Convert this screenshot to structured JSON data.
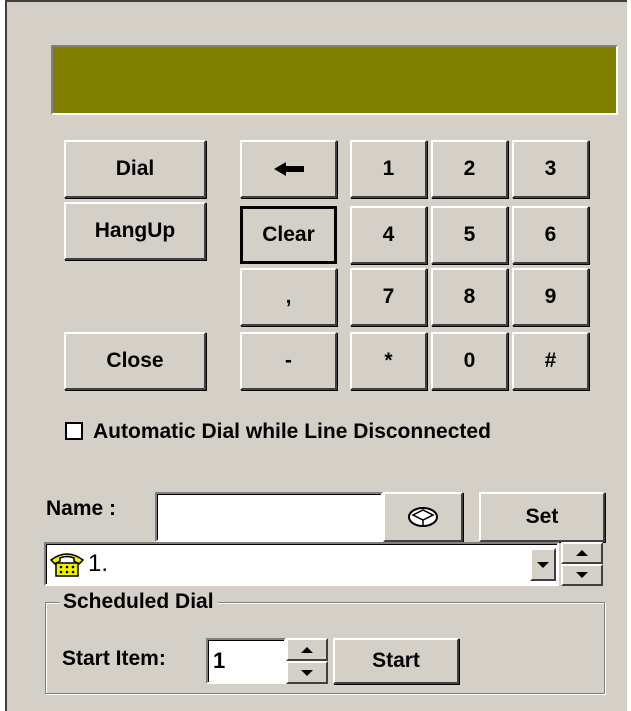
{
  "display": {
    "text": ""
  },
  "left_buttons": {
    "dial": "Dial",
    "hangup": "HangUp",
    "close": "Close"
  },
  "edit_buttons": {
    "backspace": "←",
    "clear": "Clear",
    "comma": ",",
    "dash": "-"
  },
  "keypad": [
    "1",
    "2",
    "3",
    "4",
    "5",
    "6",
    "7",
    "8",
    "9",
    "*",
    "0",
    "#"
  ],
  "auto_dial": {
    "label": "Automatic Dial while Line Disconnected",
    "checked": false
  },
  "name": {
    "label": "Name :",
    "value": "",
    "set_label": "Set"
  },
  "phonebook": {
    "selected": "1.",
    "icon": "phone-icon"
  },
  "scheduled": {
    "title": "Scheduled Dial",
    "start_item_label": "Start Item:",
    "start_item_value": "1",
    "start_label": "Start"
  },
  "colors": {
    "display_bg": "#808000",
    "face": "#d4d0c8",
    "phone_icon": "#f0f000"
  }
}
